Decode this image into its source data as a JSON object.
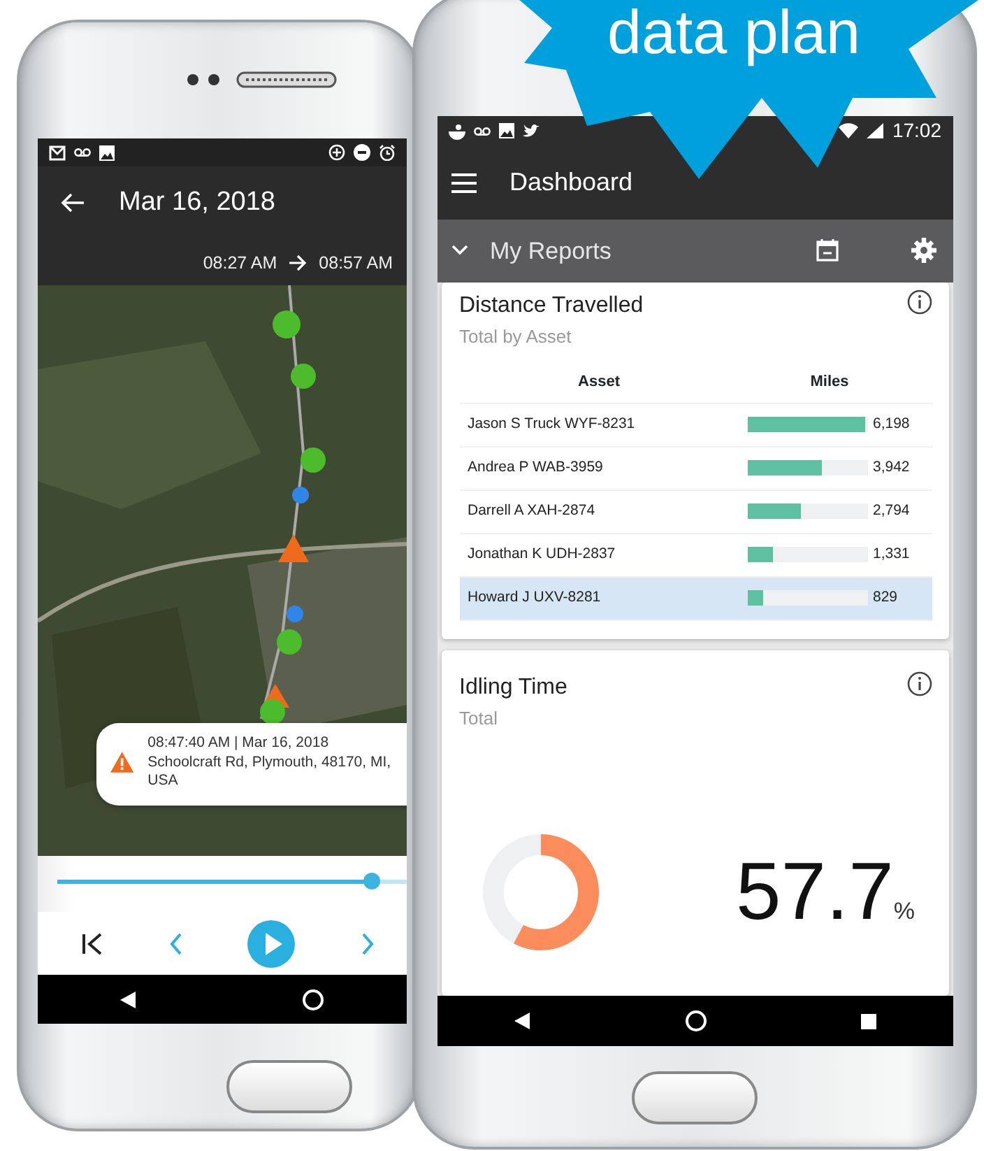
{
  "left_phone": {
    "header": {
      "title": "Mar 16, 2018",
      "start_time": "08:27 AM",
      "end_time": "08:57 AM"
    },
    "popup": {
      "time": "08:47:40 AM | Mar 16, 2018",
      "address": "Schoolcraft Rd, Plymouth, 48170, MI, USA"
    },
    "playback": {
      "level": 0.9
    }
  },
  "right_phone": {
    "status_bar": {
      "time": "17:02"
    },
    "app_bar": {
      "title": "Dashboard"
    },
    "section": {
      "title": "My Reports",
      "expanded": true
    },
    "distance_card": {
      "title": "Distance Travelled",
      "subtitle": "Total by Asset",
      "columns": [
        "Asset",
        "Miles"
      ],
      "rows": [
        {
          "asset": "Jason S Truck WYF-8231",
          "miles": "6,198",
          "level": 1.0,
          "selected": false
        },
        {
          "asset": "Andrea P WAB-3959",
          "miles": "3,942",
          "level": 0.64,
          "selected": false
        },
        {
          "asset": "Darrell A XAH-2874",
          "miles": "2,794",
          "level": 0.46,
          "selected": false
        },
        {
          "asset": "Jonathan K UDH-2837",
          "miles": "1,331",
          "level": 0.22,
          "selected": false
        },
        {
          "asset": "Howard J UXV-8281",
          "miles": "829",
          "level": 0.14,
          "selected": true
        }
      ]
    },
    "idling_card": {
      "title": "Idling Time",
      "subtitle": "Total",
      "value": "57.7",
      "unit": "%",
      "level": 0.577
    }
  },
  "badge": {
    "text": "data plan"
  }
}
